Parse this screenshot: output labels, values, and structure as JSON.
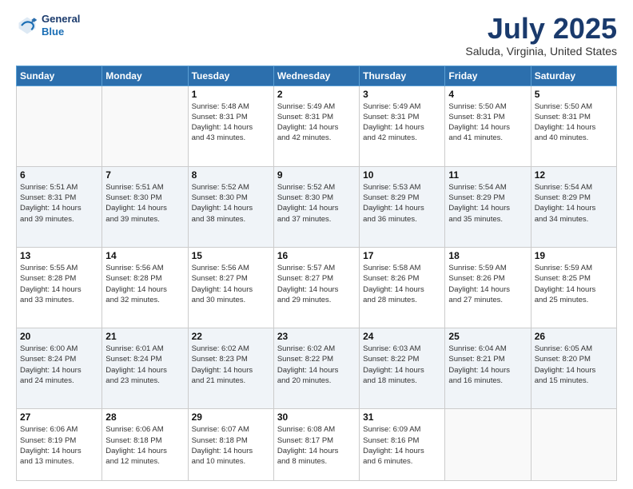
{
  "header": {
    "logo_line1": "General",
    "logo_line2": "Blue",
    "month_title": "July 2025",
    "location": "Saluda, Virginia, United States"
  },
  "days_of_week": [
    "Sunday",
    "Monday",
    "Tuesday",
    "Wednesday",
    "Thursday",
    "Friday",
    "Saturday"
  ],
  "weeks": [
    [
      {
        "day": "",
        "info": ""
      },
      {
        "day": "",
        "info": ""
      },
      {
        "day": "1",
        "info": "Sunrise: 5:48 AM\nSunset: 8:31 PM\nDaylight: 14 hours\nand 43 minutes."
      },
      {
        "day": "2",
        "info": "Sunrise: 5:49 AM\nSunset: 8:31 PM\nDaylight: 14 hours\nand 42 minutes."
      },
      {
        "day": "3",
        "info": "Sunrise: 5:49 AM\nSunset: 8:31 PM\nDaylight: 14 hours\nand 42 minutes."
      },
      {
        "day": "4",
        "info": "Sunrise: 5:50 AM\nSunset: 8:31 PM\nDaylight: 14 hours\nand 41 minutes."
      },
      {
        "day": "5",
        "info": "Sunrise: 5:50 AM\nSunset: 8:31 PM\nDaylight: 14 hours\nand 40 minutes."
      }
    ],
    [
      {
        "day": "6",
        "info": "Sunrise: 5:51 AM\nSunset: 8:31 PM\nDaylight: 14 hours\nand 39 minutes."
      },
      {
        "day": "7",
        "info": "Sunrise: 5:51 AM\nSunset: 8:30 PM\nDaylight: 14 hours\nand 39 minutes."
      },
      {
        "day": "8",
        "info": "Sunrise: 5:52 AM\nSunset: 8:30 PM\nDaylight: 14 hours\nand 38 minutes."
      },
      {
        "day": "9",
        "info": "Sunrise: 5:52 AM\nSunset: 8:30 PM\nDaylight: 14 hours\nand 37 minutes."
      },
      {
        "day": "10",
        "info": "Sunrise: 5:53 AM\nSunset: 8:29 PM\nDaylight: 14 hours\nand 36 minutes."
      },
      {
        "day": "11",
        "info": "Sunrise: 5:54 AM\nSunset: 8:29 PM\nDaylight: 14 hours\nand 35 minutes."
      },
      {
        "day": "12",
        "info": "Sunrise: 5:54 AM\nSunset: 8:29 PM\nDaylight: 14 hours\nand 34 minutes."
      }
    ],
    [
      {
        "day": "13",
        "info": "Sunrise: 5:55 AM\nSunset: 8:28 PM\nDaylight: 14 hours\nand 33 minutes."
      },
      {
        "day": "14",
        "info": "Sunrise: 5:56 AM\nSunset: 8:28 PM\nDaylight: 14 hours\nand 32 minutes."
      },
      {
        "day": "15",
        "info": "Sunrise: 5:56 AM\nSunset: 8:27 PM\nDaylight: 14 hours\nand 30 minutes."
      },
      {
        "day": "16",
        "info": "Sunrise: 5:57 AM\nSunset: 8:27 PM\nDaylight: 14 hours\nand 29 minutes."
      },
      {
        "day": "17",
        "info": "Sunrise: 5:58 AM\nSunset: 8:26 PM\nDaylight: 14 hours\nand 28 minutes."
      },
      {
        "day": "18",
        "info": "Sunrise: 5:59 AM\nSunset: 8:26 PM\nDaylight: 14 hours\nand 27 minutes."
      },
      {
        "day": "19",
        "info": "Sunrise: 5:59 AM\nSunset: 8:25 PM\nDaylight: 14 hours\nand 25 minutes."
      }
    ],
    [
      {
        "day": "20",
        "info": "Sunrise: 6:00 AM\nSunset: 8:24 PM\nDaylight: 14 hours\nand 24 minutes."
      },
      {
        "day": "21",
        "info": "Sunrise: 6:01 AM\nSunset: 8:24 PM\nDaylight: 14 hours\nand 23 minutes."
      },
      {
        "day": "22",
        "info": "Sunrise: 6:02 AM\nSunset: 8:23 PM\nDaylight: 14 hours\nand 21 minutes."
      },
      {
        "day": "23",
        "info": "Sunrise: 6:02 AM\nSunset: 8:22 PM\nDaylight: 14 hours\nand 20 minutes."
      },
      {
        "day": "24",
        "info": "Sunrise: 6:03 AM\nSunset: 8:22 PM\nDaylight: 14 hours\nand 18 minutes."
      },
      {
        "day": "25",
        "info": "Sunrise: 6:04 AM\nSunset: 8:21 PM\nDaylight: 14 hours\nand 16 minutes."
      },
      {
        "day": "26",
        "info": "Sunrise: 6:05 AM\nSunset: 8:20 PM\nDaylight: 14 hours\nand 15 minutes."
      }
    ],
    [
      {
        "day": "27",
        "info": "Sunrise: 6:06 AM\nSunset: 8:19 PM\nDaylight: 14 hours\nand 13 minutes."
      },
      {
        "day": "28",
        "info": "Sunrise: 6:06 AM\nSunset: 8:18 PM\nDaylight: 14 hours\nand 12 minutes."
      },
      {
        "day": "29",
        "info": "Sunrise: 6:07 AM\nSunset: 8:18 PM\nDaylight: 14 hours\nand 10 minutes."
      },
      {
        "day": "30",
        "info": "Sunrise: 6:08 AM\nSunset: 8:17 PM\nDaylight: 14 hours\nand 8 minutes."
      },
      {
        "day": "31",
        "info": "Sunrise: 6:09 AM\nSunset: 8:16 PM\nDaylight: 14 hours\nand 6 minutes."
      },
      {
        "day": "",
        "info": ""
      },
      {
        "day": "",
        "info": ""
      }
    ]
  ]
}
